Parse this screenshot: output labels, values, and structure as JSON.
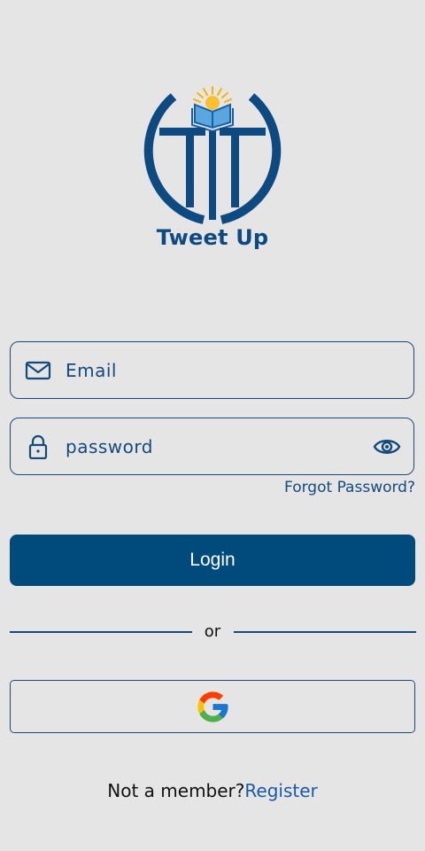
{
  "brand": {
    "name": "Tweet Up",
    "color": "#0d4a82"
  },
  "login_form": {
    "email_placeholder": "Email",
    "password_placeholder": "password",
    "forgot_password_label": "Forgot Password?",
    "login_label": "Login",
    "divider_text": "or"
  },
  "footer": {
    "prompt": "Not a member?",
    "register_label": "Register"
  },
  "icons": {
    "email": "mail-icon",
    "password": "lock-icon",
    "visibility": "eye-icon",
    "google": "google-icon"
  },
  "colors": {
    "background": "#e5e5e5",
    "primary": "#014a7c",
    "link": "#1a5aa3"
  }
}
